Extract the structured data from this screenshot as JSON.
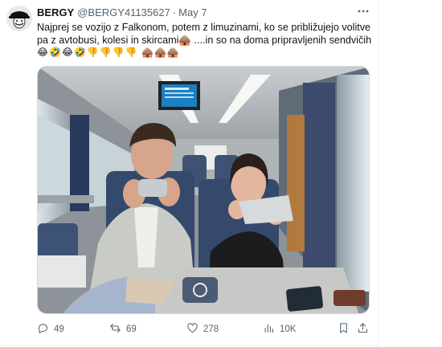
{
  "tweet": {
    "display_name": "BERGY",
    "handle": "@BERGY41135627",
    "separator": "·",
    "date": "May 7",
    "more_icon": "more-horizontal-icon",
    "text_lines": [
      "Najprej se vozijo z Falkonom, potem z limuzinami, ko se približujejo volitve",
      "pa z avtobusi, kolesi in skircami🛖 ....in so na doma pripravljenih sendvičih"
    ],
    "emoji_line": "😂🤣😂🤣👎👎👎👎 🛖🛖🛖",
    "image_alt": "Two people eating sandwiches on a train",
    "stats": {
      "replies": "49",
      "reposts": "69",
      "likes": "278",
      "views": "10K"
    },
    "icons": {
      "reply": "reply-icon",
      "repost": "repost-icon",
      "like": "heart-icon",
      "views": "views-icon",
      "bookmark": "bookmark-icon",
      "share": "share-icon"
    }
  },
  "colors": {
    "text_primary": "#0f1419",
    "text_secondary": "#536471",
    "border": "#cfd9de",
    "train_seat_blue": "#3d5275"
  }
}
